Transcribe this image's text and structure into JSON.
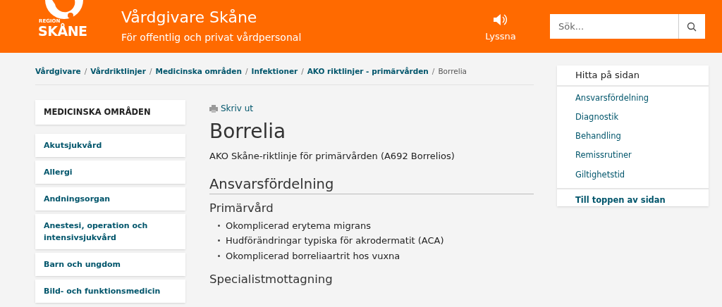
{
  "header": {
    "logo_small": "REGION",
    "logo_big": "SKÅNE",
    "title": "Vårdgivare Skåne",
    "subtitle": "För offentlig och privat vårdpersonal",
    "listen": "Lyssna",
    "search": {
      "placeholder": "Sök..."
    }
  },
  "breadcrumb": [
    {
      "label": "Vårdgivare",
      "separator": "/",
      "current": false
    },
    {
      "label": "Vårdriktlinjer",
      "separator": "/",
      "current": false
    },
    {
      "label": "Medicinska områden",
      "separator": "/",
      "current": false
    },
    {
      "label": "Infektioner",
      "separator": "/",
      "current": false
    },
    {
      "label": "AKO riktlinjer - primärvården",
      "separator": "/",
      "current": false
    },
    {
      "label": "Borrelia",
      "current": true
    }
  ],
  "sidebar": {
    "heading": "MEDICINSKA OMRÅDEN",
    "items": [
      "Akutsjukvård",
      "Allergi",
      "Andningsorgan",
      "Anestesi, operation och intensivsjukvård",
      "Barn och ungdom",
      "Bild- och funktionsmedicin"
    ]
  },
  "article": {
    "print": "Skriv ut",
    "title": "Borrelia",
    "lead": "AKO Skåne-riktlinje för primärvården (A692 Borrelios)",
    "section": "Ansvarsfördelning",
    "subsections": [
      {
        "heading": "Primärvård",
        "bullets": [
          "Okomplicerad erytema migrans",
          "Hudförändringar typiska för akrodermatit (ACA)",
          "Okomplicerad borreliaartrit hos vuxna"
        ]
      },
      {
        "heading": "Specialistmottagning"
      }
    ]
  },
  "toc": {
    "heading": "Hitta på sidan",
    "links": [
      "Ansvarsfördelning",
      "Diagnostik",
      "Behandling",
      "Remissrutiner",
      "Giltighetstid"
    ],
    "top": "Till toppen av sidan"
  }
}
